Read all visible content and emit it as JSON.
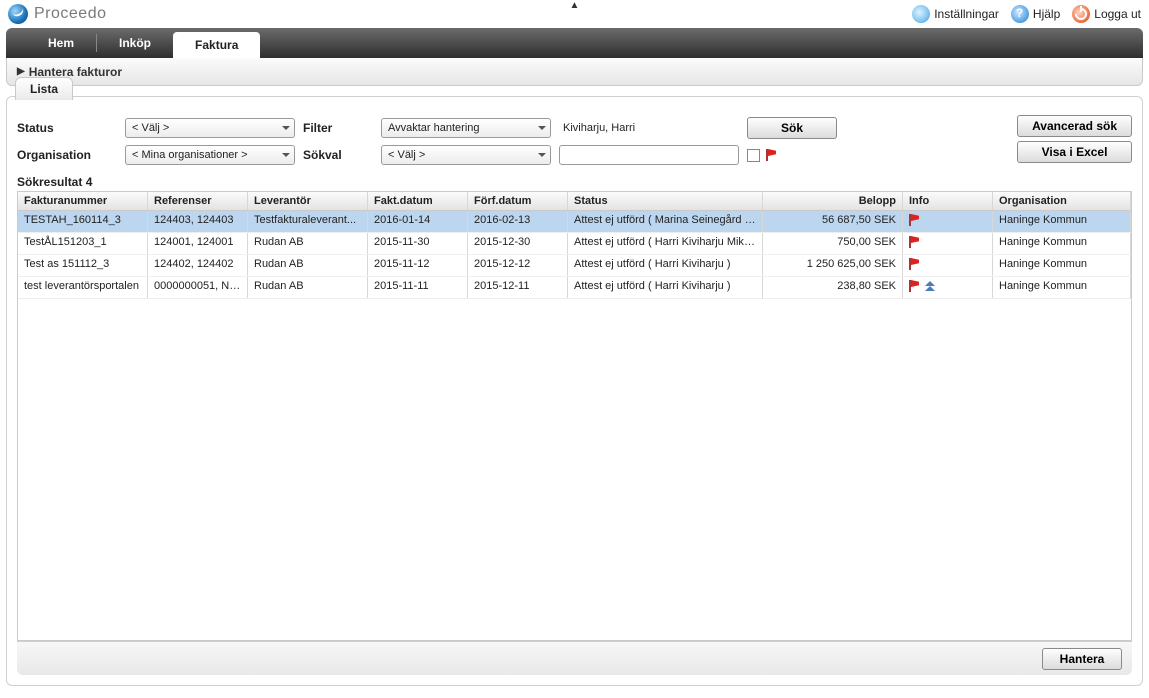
{
  "brand": "Proceedo",
  "top": {
    "settings": "Inställningar",
    "help": "Hjälp",
    "logout": "Logga ut"
  },
  "nav": {
    "home": "Hem",
    "purchase": "Inköp",
    "invoice": "Faktura"
  },
  "subnav": "Hantera fakturor",
  "tab": "Lista",
  "filters": {
    "status_lbl": "Status",
    "status_val": "< Välj >",
    "filter_lbl": "Filter",
    "filter_val": "Avvaktar hantering",
    "user": "Kiviharju, Harri",
    "search_btn": "Sök",
    "org_lbl": "Organisation",
    "org_val": "< Mina organisationer >",
    "sokval_lbl": "Sökval",
    "sokval_val": "< Välj >",
    "adv_btn": "Avancerad sök",
    "excel_btn": "Visa i Excel"
  },
  "result_label": "Sökresultat 4",
  "columns": [
    "Fakturanummer",
    "Referenser",
    "Leverantör",
    "Fakt.datum",
    "Förf.datum",
    "Status",
    "Belopp",
    "Info",
    "Organisation"
  ],
  "rows": [
    {
      "num": "TESTAH_160114_3",
      "ref": "124403, 124403",
      "lev": "Testfakturaleverant...",
      "fd": "2016-01-14",
      "ffd": "2016-02-13",
      "status": "Attest ej utförd ( Marina Seinegård H...",
      "belopp": "56 687,50 SEK",
      "info": "flag",
      "org": "Haninge Kommun",
      "selected": true
    },
    {
      "num": "TestÅL151203_1",
      "ref": "124001, 124001",
      "lev": "Rudan AB",
      "fd": "2015-11-30",
      "ffd": "2015-12-30",
      "status": "Attest ej utförd ( Harri Kiviharju Mika...",
      "belopp": "750,00 SEK",
      "info": "flag",
      "org": "Haninge Kommun"
    },
    {
      "num": "Test as 151112_3",
      "ref": "124402, 124402",
      "lev": "Rudan AB",
      "fd": "2015-11-12",
      "ffd": "2015-12-12",
      "status": "Attest ej utförd ( Harri Kiviharju )",
      "belopp": "1 250 625,00 SEK",
      "info": "flag",
      "org": "Haninge Kommun"
    },
    {
      "num": "test leverantörsportalen",
      "ref": "0000000051, Ny...",
      "lev": "Rudan AB",
      "fd": "2015-11-11",
      "ffd": "2015-12-11",
      "status": "Attest ej utförd ( Harri Kiviharju )",
      "belopp": "238,80 SEK",
      "info": "flag-up",
      "org": "Haninge Kommun"
    }
  ],
  "footer": {
    "manage": "Hantera"
  }
}
